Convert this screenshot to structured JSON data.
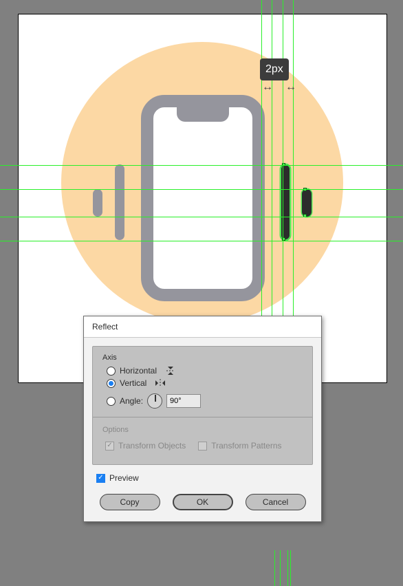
{
  "tooltip": {
    "distance": "2px"
  },
  "guides": {
    "vertical_x": [
      380,
      395,
      411,
      426
    ],
    "horizontal_y": [
      217,
      254,
      293,
      327
    ],
    "bottom_vertical_x": [
      399,
      407,
      418,
      422
    ]
  },
  "dialog": {
    "title": "Reflect",
    "axis": {
      "label": "Axis",
      "horizontal": "Horizontal",
      "vertical": "Vertical",
      "angle": "Angle:",
      "angle_value": "90°",
      "selected": "vertical"
    },
    "options": {
      "label": "Options",
      "transform_objects": "Transform Objects",
      "transform_patterns": "Transform Patterns",
      "transform_objects_checked": true,
      "transform_patterns_checked": false
    },
    "preview": {
      "label": "Preview",
      "checked": true
    },
    "buttons": {
      "copy": "Copy",
      "ok": "OK",
      "cancel": "Cancel"
    }
  }
}
